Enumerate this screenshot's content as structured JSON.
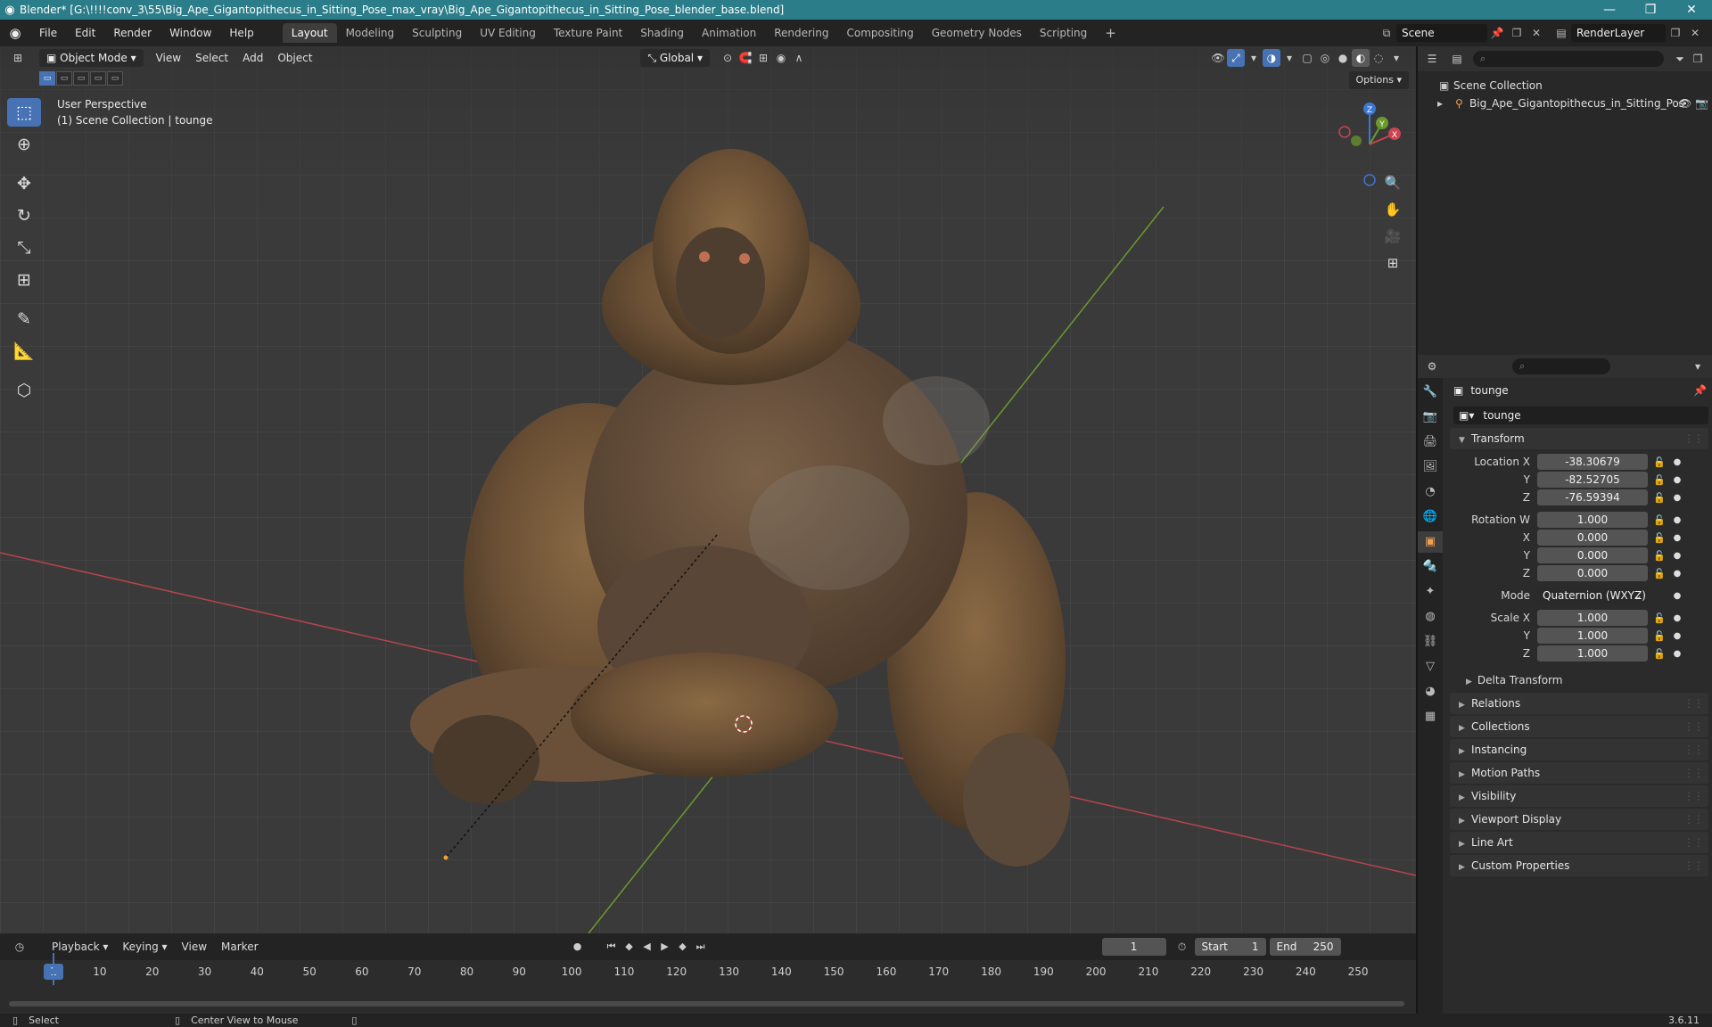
{
  "window": {
    "title": "Blender* [G:\\!!!!conv_3\\55\\Big_Ape_Gigantopithecus_in_Sitting_Pose_max_vray\\Big_Ape_Gigantopithecus_in_Sitting_Pose_blender_base.blend]"
  },
  "menu": {
    "file": "File",
    "edit": "Edit",
    "render": "Render",
    "window": "Window",
    "help": "Help"
  },
  "workspaces": [
    "Layout",
    "Modeling",
    "Sculpting",
    "UV Editing",
    "Texture Paint",
    "Shading",
    "Animation",
    "Rendering",
    "Compositing",
    "Geometry Nodes",
    "Scripting"
  ],
  "active_workspace": "Layout",
  "scene": {
    "name": "Scene",
    "view_layer": "RenderLayer"
  },
  "viewport": {
    "mode": "Object Mode",
    "menus": {
      "view": "View",
      "select": "Select",
      "add": "Add",
      "object": "Object"
    },
    "orientation": "Global",
    "options": "Options",
    "info_line1": "User Perspective",
    "info_line2": "(1) Scene Collection | tounge",
    "gizmo_axes": {
      "z": "Z",
      "y": "Y",
      "x": "X"
    }
  },
  "outliner": {
    "root": "Scene Collection",
    "items": [
      {
        "name": "Big_Ape_Gigantopithecus_in_Sitting_Pos"
      }
    ]
  },
  "properties": {
    "object_name": "tounge",
    "datablock_name": "tounge",
    "transform_label": "Transform",
    "location": {
      "label_x": "Location X",
      "label_y": "Y",
      "label_z": "Z",
      "x": "-38.30679",
      "y": "-82.52705",
      "z": "-76.59394"
    },
    "rotation": {
      "label_w": "Rotation W",
      "label_x": "X",
      "label_y": "Y",
      "label_z": "Z",
      "w": "1.000",
      "x": "0.000",
      "y": "0.000",
      "z": "0.000"
    },
    "mode": {
      "label": "Mode",
      "value": "Quaternion (WXYZ)"
    },
    "scale": {
      "label_x": "Scale X",
      "label_y": "Y",
      "label_z": "Z",
      "x": "1.000",
      "y": "1.000",
      "z": "1.000"
    },
    "delta_transform": "Delta Transform",
    "panels": [
      "Relations",
      "Collections",
      "Instancing",
      "Motion Paths",
      "Visibility",
      "Viewport Display",
      "Line Art",
      "Custom Properties"
    ]
  },
  "timeline": {
    "menus": {
      "playback": "Playback",
      "keying": "Keying",
      "view": "View",
      "marker": "Marker"
    },
    "current_frame": "1",
    "start_label": "Start",
    "start": "1",
    "end_label": "End",
    "end": "250",
    "ruler": [
      "10",
      "20",
      "30",
      "40",
      "50",
      "60",
      "70",
      "80",
      "90",
      "100",
      "110",
      "120",
      "130",
      "140",
      "150",
      "160",
      "170",
      "180",
      "190",
      "200",
      "210",
      "220",
      "230",
      "240",
      "250"
    ]
  },
  "status": {
    "select": "Select",
    "center_view": "Center View to Mouse",
    "version": "3.6.11"
  },
  "colors": {
    "accent": "#4772b3",
    "titlebar": "#2b7d8a",
    "x_axis": "#c9444f",
    "y_axis": "#6b9a2c",
    "z_axis": "#3a78d4"
  }
}
